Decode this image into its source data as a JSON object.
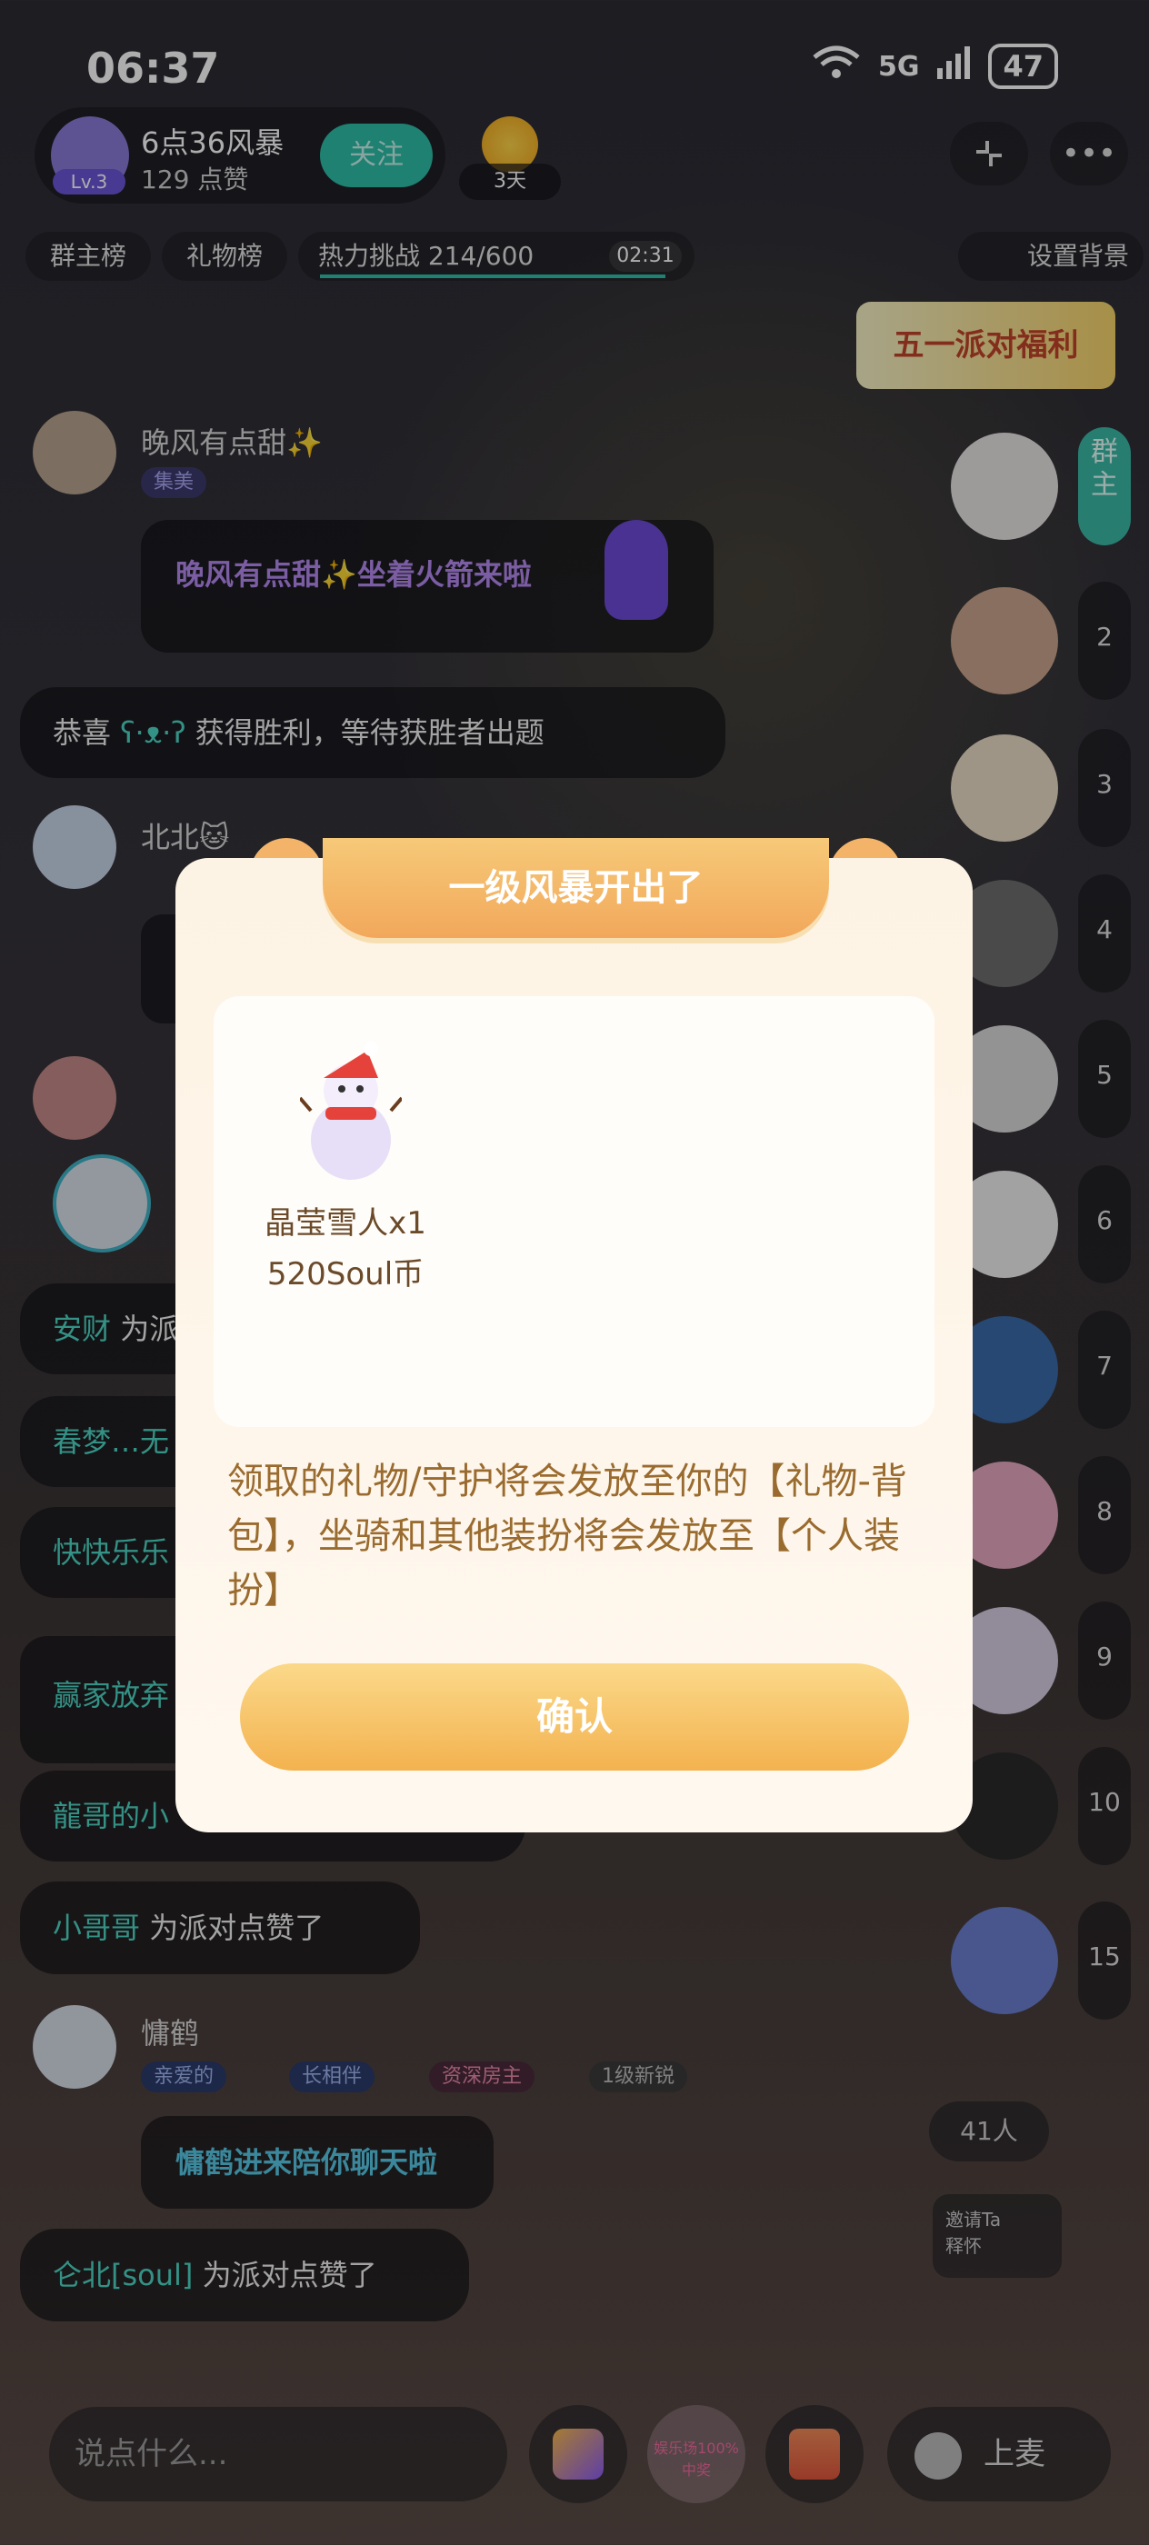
{
  "status_bar": {
    "time": "06:37",
    "network": "5G",
    "battery": "47"
  },
  "host": {
    "name": "6点36风暴",
    "likes": "129 点赞",
    "level": "Lv.3",
    "follow_label": "关注",
    "days_badge": "3天"
  },
  "chips": {
    "rank_host": "群主榜",
    "rank_gift": "礼物榜",
    "heat_challenge": "热力挑战 214/600",
    "heat_timer": "02:31",
    "set_background": "设置背景"
  },
  "promo_banner": "五一派对福利",
  "chat": {
    "msg1": {
      "user": "晚风有点甜✨",
      "tag": "集美",
      "text": "晚风有点甜✨坐着火箭来啦"
    },
    "msg2": {
      "prefix": "恭喜",
      "name": "ʕ·ᴥ·ʔ",
      "suffix": "获得胜利，等待获胜者出题"
    },
    "msg3": {
      "user": "北北🐱"
    },
    "line_anchai": {
      "name": "安财",
      "text": "为派"
    },
    "line_chunmeng": {
      "name": "春梦…无"
    },
    "line_kuaile": {
      "name": "快快乐乐"
    },
    "line_yingjia": {
      "name": "赢家放弃"
    },
    "line_longge": {
      "name": "龍哥的小"
    },
    "line_xiaogege": {
      "name": "小哥哥",
      "text": "为派对点赞了"
    },
    "msg_yonghe": {
      "user": "慵鹤",
      "tags": [
        "亲爱的",
        "长相伴",
        "资深房主",
        "1级新锐"
      ],
      "text": "慵鹤进来陪你聊天啦"
    },
    "line_lunbei": {
      "name": "仑北[soul]",
      "text": "为派对点赞了"
    }
  },
  "rank_list": {
    "owner_label": "群主",
    "numbers": [
      "2",
      "3",
      "4",
      "5",
      "6",
      "7",
      "8",
      "9",
      "10",
      "15"
    ],
    "member_count": "41人",
    "invite": "邀请Ta",
    "invite_sub": "释怀"
  },
  "modal": {
    "title": "一级风暴开出了",
    "gift_name": "晶莹雪人x1",
    "gift_price": "520Soul币",
    "description": "领取的礼物/守护将会发放至你的【礼物-背包】，坐骑和其他装扮将会发放至【个人装扮】",
    "confirm": "确认"
  },
  "bottom_bar": {
    "input_placeholder": "说点什么...",
    "game_badge": "娱乐场100%中奖",
    "mic_label": "上麦"
  }
}
